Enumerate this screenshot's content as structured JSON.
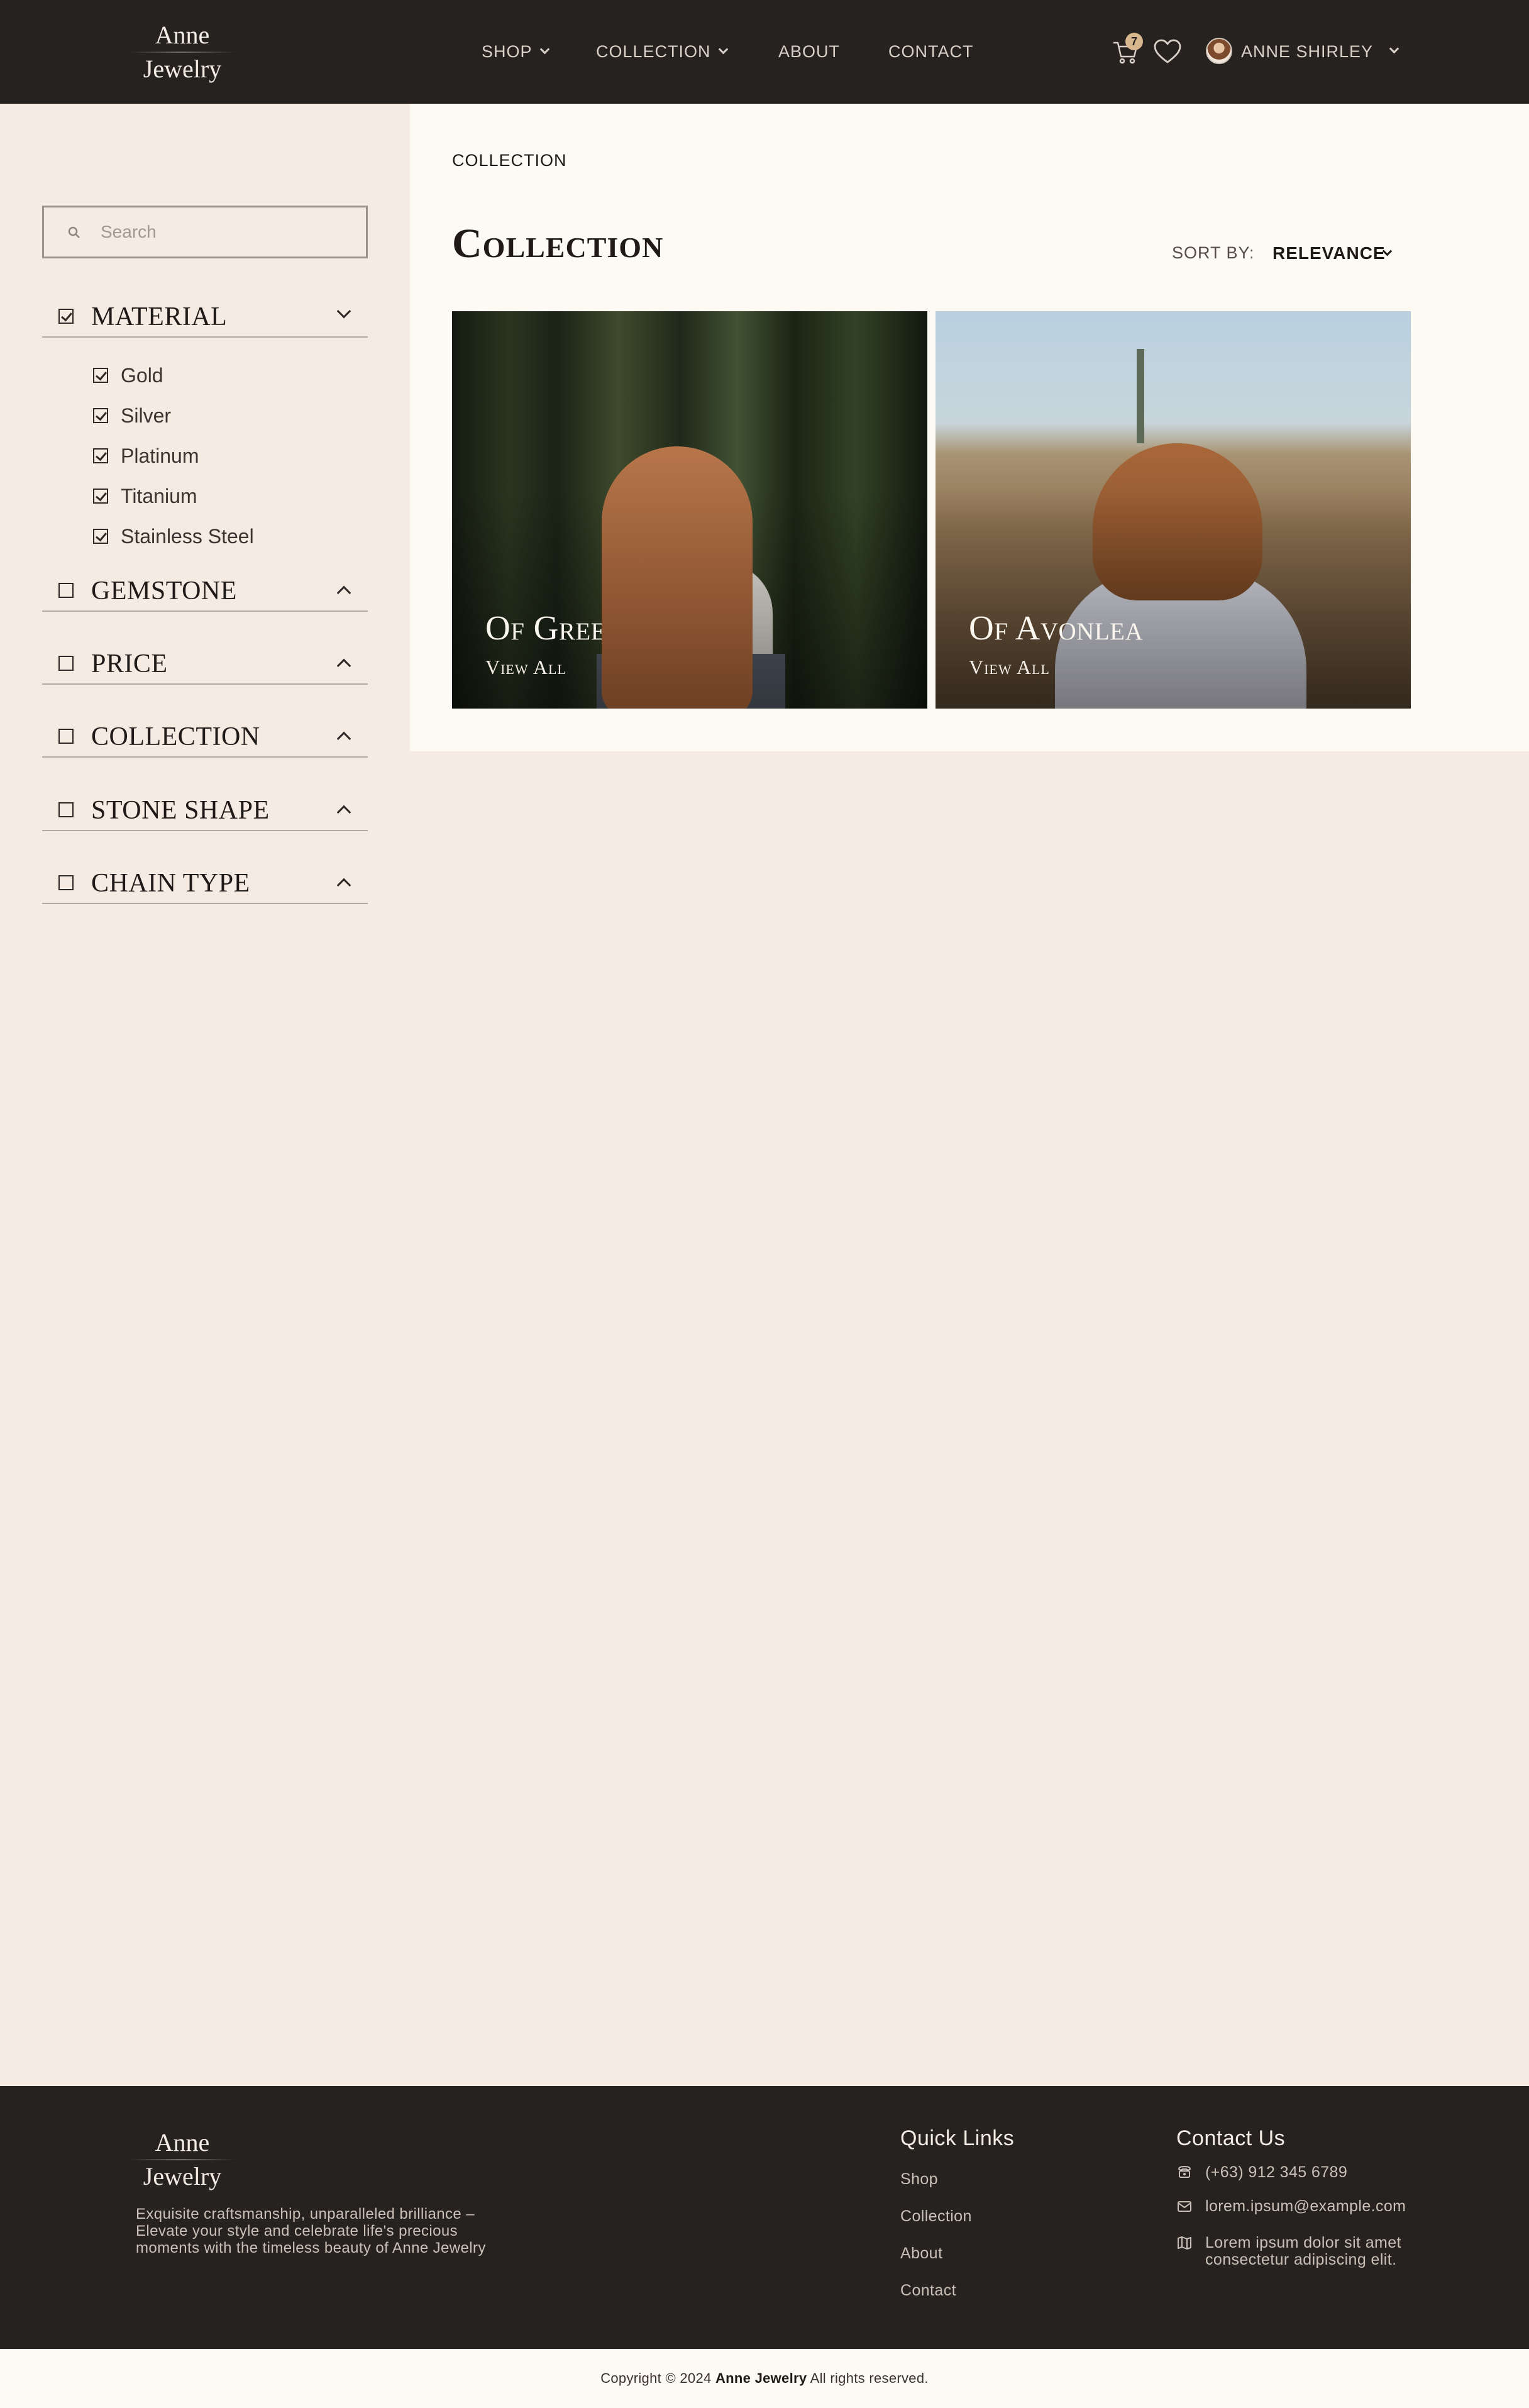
{
  "brand": {
    "line1": "Anne",
    "line2": "Jewelry"
  },
  "header": {
    "nav": [
      {
        "label": "SHOP",
        "has_dropdown": true
      },
      {
        "label": "COLLECTION",
        "has_dropdown": true
      },
      {
        "label": "ABOUT",
        "has_dropdown": false
      },
      {
        "label": "CONTACT",
        "has_dropdown": false
      }
    ],
    "cart_count": "7",
    "user_name": "ANNE SHIRLEY",
    "icons": [
      "cart-icon",
      "heart-icon",
      "avatar",
      "chevron-down-icon"
    ]
  },
  "sidebar": {
    "search_placeholder": "Search",
    "filters": [
      {
        "label": "MATERIAL",
        "checked": true,
        "expanded": true,
        "options": [
          {
            "label": "Gold",
            "checked": true
          },
          {
            "label": "Silver",
            "checked": true
          },
          {
            "label": "Platinum",
            "checked": true
          },
          {
            "label": "Titanium",
            "checked": true
          },
          {
            "label": "Stainless Steel",
            "checked": true
          }
        ]
      },
      {
        "label": "GEMSTONE",
        "checked": false,
        "expanded": false
      },
      {
        "label": "PRICE",
        "checked": false,
        "expanded": false
      },
      {
        "label": "COLLECTION",
        "checked": false,
        "expanded": false
      },
      {
        "label": "STONE SHAPE",
        "checked": false,
        "expanded": false
      },
      {
        "label": "CHAIN TYPE",
        "checked": false,
        "expanded": false
      }
    ]
  },
  "main": {
    "breadcrumb": "COLLECTION",
    "title": "Collection",
    "sort_label": "SORT BY:",
    "sort_value": "RELEVANCE",
    "cards": [
      {
        "title": "Of Green Gables",
        "link": "View All"
      },
      {
        "title": "Of Avonlea",
        "link": "View All"
      }
    ]
  },
  "footer": {
    "description": "Exquisite craftsmanship, unparalleled brilliance – Elevate your style and celebrate life's precious moments with the timeless beauty of Anne Jewelry",
    "quick_links_title": "Quick Links",
    "quick_links": [
      "Shop",
      "Collection",
      "About",
      "Contact"
    ],
    "contact_title": "Contact Us",
    "phone": "(+63) 912 345 6789",
    "email": "lorem.ipsum@example.com",
    "address": "Lorem ipsum dolor sit amet consectetur adipiscing elit."
  },
  "copyright": {
    "prefix": "Copyright © 2024",
    "brand": "Anne Jewelry",
    "suffix": "All rights reserved."
  },
  "colors": {
    "header_bg": "#262220",
    "page_bg": "#f5ebe3",
    "panel_bg": "#fdf9f3",
    "badge": "#d8b68e"
  }
}
